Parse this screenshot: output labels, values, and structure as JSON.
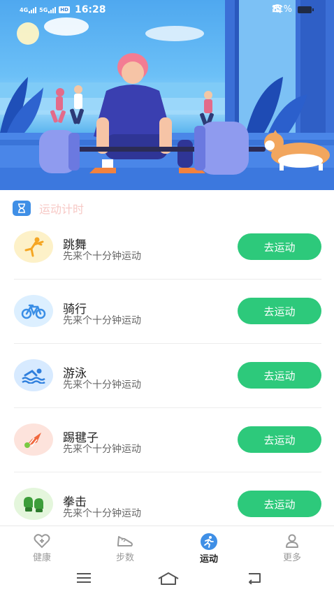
{
  "status_bar": {
    "network_1": "4G",
    "network_2": "5G",
    "hd": "HD",
    "time": "16:28",
    "battery": "81%"
  },
  "section": {
    "title": "运动计时",
    "icon": "hourglass-icon"
  },
  "activities": [
    {
      "name": "跳舞",
      "desc": "先来个十分钟运动",
      "button": "去运动",
      "icon": "dance-icon",
      "bg": "#fdf1c8"
    },
    {
      "name": "骑行",
      "desc": "先来个十分钟运动",
      "button": "去运动",
      "icon": "bicycle-icon",
      "bg": "#dcefff"
    },
    {
      "name": "游泳",
      "desc": "先来个十分钟运动",
      "button": "去运动",
      "icon": "swim-icon",
      "bg": "#d7eaff"
    },
    {
      "name": "踢毽子",
      "desc": "先来个十分钟运动",
      "button": "去运动",
      "icon": "shuttlecock-icon",
      "bg": "#fde3dc"
    },
    {
      "name": "拳击",
      "desc": "先来个十分钟运动",
      "button": "去运动",
      "icon": "boxing-glove-icon",
      "bg": "#e4f6dc"
    }
  ],
  "tabs": [
    {
      "label": "健康",
      "icon": "heart-plus-icon",
      "active": false
    },
    {
      "label": "步数",
      "icon": "shoe-icon",
      "active": false
    },
    {
      "label": "运动",
      "icon": "runner-icon",
      "active": true
    },
    {
      "label": "更多",
      "icon": "person-icon",
      "active": false
    }
  ],
  "colors": {
    "accent": "#2dc97b",
    "active_tab": "#3f8fe6",
    "section_title": "#f7c9c6"
  }
}
